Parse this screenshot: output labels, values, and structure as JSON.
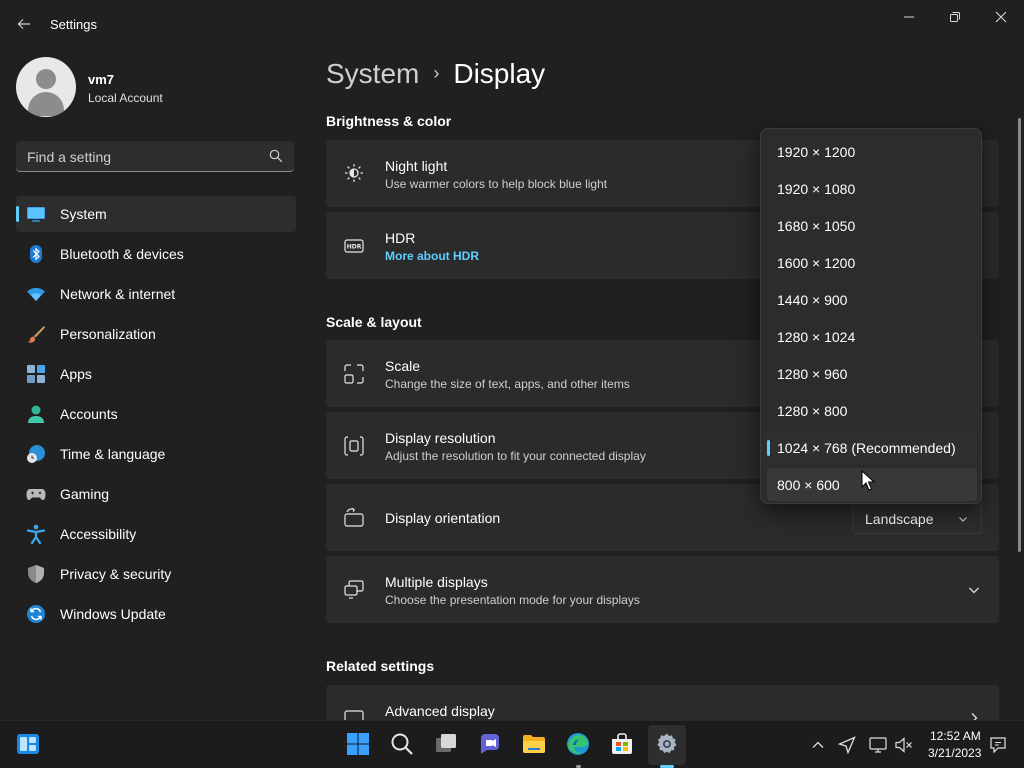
{
  "window": {
    "app_title": "Settings"
  },
  "profile": {
    "name": "vm7",
    "account_type": "Local Account"
  },
  "search": {
    "placeholder": "Find a setting"
  },
  "sidebar": {
    "items": [
      {
        "label": "System",
        "icon": "system-icon",
        "active": true
      },
      {
        "label": "Bluetooth & devices",
        "icon": "bluetooth-icon"
      },
      {
        "label": "Network & internet",
        "icon": "wifi-icon"
      },
      {
        "label": "Personalization",
        "icon": "brush-icon"
      },
      {
        "label": "Apps",
        "icon": "apps-icon"
      },
      {
        "label": "Accounts",
        "icon": "account-icon"
      },
      {
        "label": "Time & language",
        "icon": "clock-globe-icon"
      },
      {
        "label": "Gaming",
        "icon": "gamepad-icon"
      },
      {
        "label": "Accessibility",
        "icon": "accessibility-icon"
      },
      {
        "label": "Privacy & security",
        "icon": "shield-icon"
      },
      {
        "label": "Windows Update",
        "icon": "update-icon"
      }
    ]
  },
  "breadcrumb": {
    "parent": "System",
    "separator": "›",
    "current": "Display"
  },
  "sections": {
    "brightness": "Brightness & color",
    "scale_layout": "Scale & layout",
    "related": "Related settings"
  },
  "cards": {
    "night_light": {
      "title": "Night light",
      "subtitle": "Use warmer colors to help block blue light"
    },
    "hdr": {
      "title": "HDR",
      "link": "More about HDR"
    },
    "scale": {
      "title": "Scale",
      "subtitle": "Change the size of text, apps, and other items"
    },
    "resolution": {
      "title": "Display resolution",
      "subtitle": "Adjust the resolution to fit your connected display"
    },
    "orientation": {
      "title": "Display orientation",
      "value": "Landscape"
    },
    "multiple": {
      "title": "Multiple displays",
      "subtitle": "Choose the presentation mode for your displays"
    },
    "advanced": {
      "title": "Advanced display"
    }
  },
  "resolution_dropdown": {
    "options": [
      "1920 × 1200",
      "1920 × 1080",
      "1680 × 1050",
      "1600 × 1200",
      "1440 × 900",
      "1280 × 1024",
      "1280 × 960",
      "1280 × 800",
      "1024 × 768 (Recommended)",
      "800 × 600"
    ],
    "selected": "1024 × 768 (Recommended)",
    "hovered": "800 × 600"
  },
  "taskbar": {
    "apps": [
      "start-icon",
      "search-icon",
      "task-view-icon",
      "teams-chat-icon",
      "file-explorer-icon",
      "edge-icon",
      "store-icon",
      "settings-icon"
    ],
    "time": "12:52 AM",
    "date": "3/21/2023"
  },
  "colors": {
    "accent": "#60cdff",
    "background": "#202020",
    "card": "#2b2b2b"
  }
}
